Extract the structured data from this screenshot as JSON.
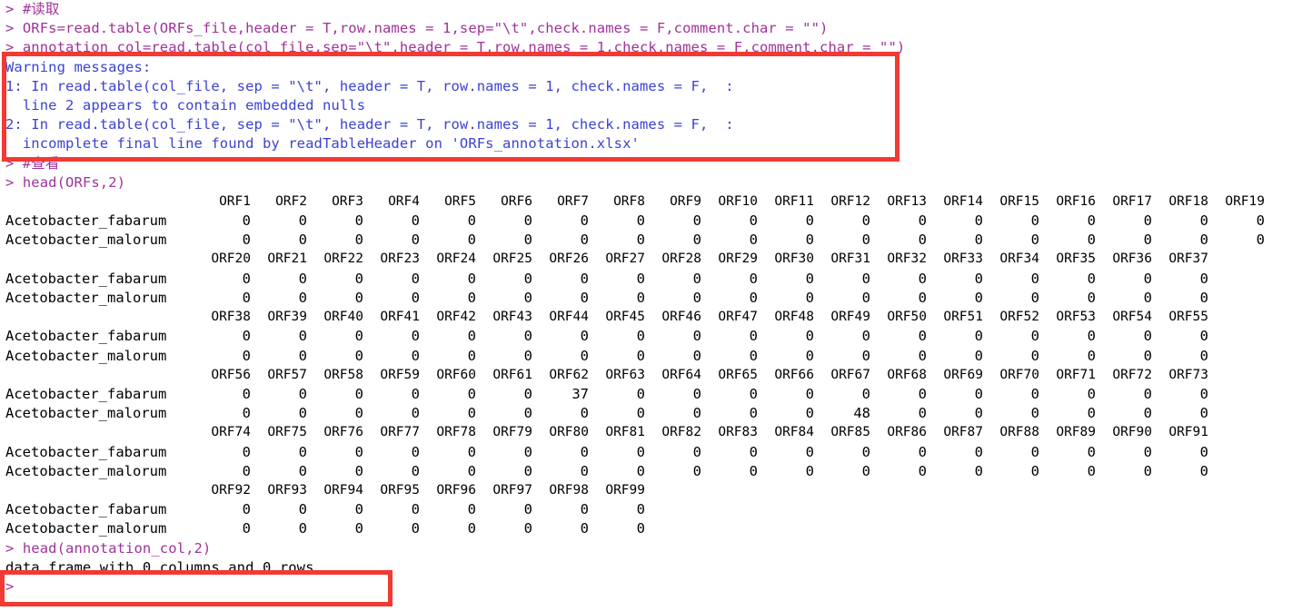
{
  "console": {
    "prompt": ">",
    "colors": {
      "command": "#a0329b",
      "warning": "#3b43d0",
      "output": "#000000",
      "annotation_box": "#f23a33",
      "background": "#ffffff"
    },
    "lines": [
      {
        "type": "command",
        "text": "> #读取"
      },
      {
        "type": "command",
        "text": "> ORFs=read.table(ORFs_file,header = T,row.names = 1,sep=\"\\t\",check.names = F,comment.char = \"\")"
      },
      {
        "type": "command",
        "text": "> annotation_col=read.table(col_file,sep=\"\\t\",header = T,row.names = 1,check.names = F,comment.char = \"\")"
      }
    ],
    "warning_block": {
      "title": "Warning messages:",
      "entries": [
        {
          "header": "1: In read.table(col_file, sep = \"\\t\", header = T, row.names = 1, check.names = F,  :",
          "detail": "  line 2 appears to contain embedded nulls"
        },
        {
          "header": "2: In read.table(col_file, sep = \"\\t\", header = T, row.names = 1, check.names = F,  :",
          "detail": "  incomplete final line found by readTableHeader on 'ORFs_annotation.xlsx'"
        }
      ]
    },
    "section_two": {
      "comment_line": "> #查看",
      "head_command": "> head(ORFs,2)"
    },
    "section_three": {
      "head_command": "> head(annotation_col,2)",
      "result": "data frame with 0 columns and 0 rows"
    }
  },
  "chart_data": {
    "type": "table",
    "title": "head(ORFs,2)",
    "row_names": [
      "Acetobacter_fabarum",
      "Acetobacter_malorum"
    ],
    "wrapped_blocks": [
      {
        "columns": [
          "ORF1",
          "ORF2",
          "ORF3",
          "ORF4",
          "ORF5",
          "ORF6",
          "ORF7",
          "ORF8",
          "ORF9",
          "ORF10",
          "ORF11",
          "ORF12",
          "ORF13",
          "ORF14",
          "ORF15",
          "ORF16",
          "ORF17",
          "ORF18",
          "ORF19"
        ],
        "rows": [
          [
            "0",
            "0",
            "0",
            "0",
            "0",
            "0",
            "0",
            "0",
            "0",
            "0",
            "0",
            "0",
            "0",
            "0",
            "0",
            "0",
            "0",
            "0",
            "0"
          ],
          [
            "0",
            "0",
            "0",
            "0",
            "0",
            "0",
            "0",
            "0",
            "0",
            "0",
            "0",
            "0",
            "0",
            "0",
            "0",
            "0",
            "0",
            "0",
            "0"
          ]
        ]
      },
      {
        "columns": [
          "ORF20",
          "ORF21",
          "ORF22",
          "ORF23",
          "ORF24",
          "ORF25",
          "ORF26",
          "ORF27",
          "ORF28",
          "ORF29",
          "ORF30",
          "ORF31",
          "ORF32",
          "ORF33",
          "ORF34",
          "ORF35",
          "ORF36",
          "ORF37"
        ],
        "rows": [
          [
            "0",
            "0",
            "0",
            "0",
            "0",
            "0",
            "0",
            "0",
            "0",
            "0",
            "0",
            "0",
            "0",
            "0",
            "0",
            "0",
            "0",
            "0"
          ],
          [
            "0",
            "0",
            "0",
            "0",
            "0",
            "0",
            "0",
            "0",
            "0",
            "0",
            "0",
            "0",
            "0",
            "0",
            "0",
            "0",
            "0",
            "0"
          ]
        ]
      },
      {
        "columns": [
          "ORF38",
          "ORF39",
          "ORF40",
          "ORF41",
          "ORF42",
          "ORF43",
          "ORF44",
          "ORF45",
          "ORF46",
          "ORF47",
          "ORF48",
          "ORF49",
          "ORF50",
          "ORF51",
          "ORF52",
          "ORF53",
          "ORF54",
          "ORF55"
        ],
        "rows": [
          [
            "0",
            "0",
            "0",
            "0",
            "0",
            "0",
            "0",
            "0",
            "0",
            "0",
            "0",
            "0",
            "0",
            "0",
            "0",
            "0",
            "0",
            "0"
          ],
          [
            "0",
            "0",
            "0",
            "0",
            "0",
            "0",
            "0",
            "0",
            "0",
            "0",
            "0",
            "0",
            "0",
            "0",
            "0",
            "0",
            "0",
            "0"
          ]
        ]
      },
      {
        "columns": [
          "ORF56",
          "ORF57",
          "ORF58",
          "ORF59",
          "ORF60",
          "ORF61",
          "ORF62",
          "ORF63",
          "ORF64",
          "ORF65",
          "ORF66",
          "ORF67",
          "ORF68",
          "ORF69",
          "ORF70",
          "ORF71",
          "ORF72",
          "ORF73"
        ],
        "rows": [
          [
            "0",
            "0",
            "0",
            "0",
            "0",
            "0",
            "37",
            "0",
            "0",
            "0",
            "0",
            "0",
            "0",
            "0",
            "0",
            "0",
            "0",
            "0"
          ],
          [
            "0",
            "0",
            "0",
            "0",
            "0",
            "0",
            "0",
            "0",
            "0",
            "0",
            "0",
            "48",
            "0",
            "0",
            "0",
            "0",
            "0",
            "0"
          ]
        ]
      },
      {
        "columns": [
          "ORF74",
          "ORF75",
          "ORF76",
          "ORF77",
          "ORF78",
          "ORF79",
          "ORF80",
          "ORF81",
          "ORF82",
          "ORF83",
          "ORF84",
          "ORF85",
          "ORF86",
          "ORF87",
          "ORF88",
          "ORF89",
          "ORF90",
          "ORF91"
        ],
        "rows": [
          [
            "0",
            "0",
            "0",
            "0",
            "0",
            "0",
            "0",
            "0",
            "0",
            "0",
            "0",
            "0",
            "0",
            "0",
            "0",
            "0",
            "0",
            "0"
          ],
          [
            "0",
            "0",
            "0",
            "0",
            "0",
            "0",
            "0",
            "0",
            "0",
            "0",
            "0",
            "0",
            "0",
            "0",
            "0",
            "0",
            "0",
            "0"
          ]
        ]
      },
      {
        "columns": [
          "ORF92",
          "ORF93",
          "ORF94",
          "ORF95",
          "ORF96",
          "ORF97",
          "ORF98",
          "ORF99"
        ],
        "rows": [
          [
            "0",
            "0",
            "0",
            "0",
            "0",
            "0",
            "0",
            "0"
          ],
          [
            "0",
            "0",
            "0",
            "0",
            "0",
            "0",
            "0",
            "0"
          ]
        ]
      }
    ]
  },
  "annotations": {
    "box_warnings_label": "red-highlight-warning-messages",
    "box_dataframe_label": "red-highlight-empty-dataframe"
  }
}
